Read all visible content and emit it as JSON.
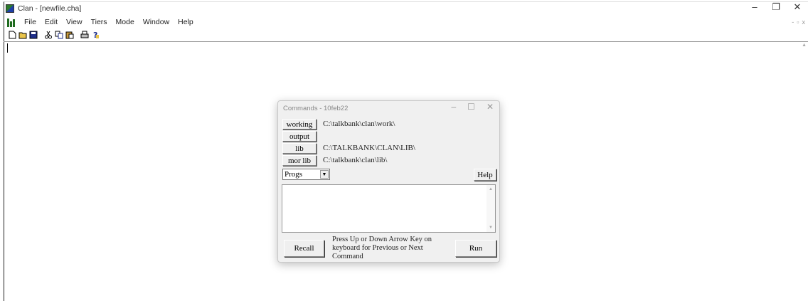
{
  "window": {
    "title": "Clan - [newfile.cha]",
    "minimize": "–",
    "restore": "❐",
    "close": "✕"
  },
  "menu": {
    "items": [
      "File",
      "Edit",
      "View",
      "Tiers",
      "Mode",
      "Window",
      "Help"
    ]
  },
  "mdi_controls": {
    "minimize": "-",
    "restore": "▫",
    "close": "x"
  },
  "toolbar": {
    "buttons": [
      "new-file",
      "open-file",
      "save",
      "cut",
      "copy",
      "paste",
      "print",
      "help"
    ]
  },
  "dialog": {
    "title": "Commands - 10feb22",
    "minimize": "–",
    "maximize": "☐",
    "close": "✕",
    "working_label": "working",
    "working_path": "C:\\talkbank\\clan\\work\\",
    "output_label": "output",
    "output_path": "",
    "lib_label": "lib",
    "lib_path": "C:\\TALKBANK\\CLAN\\LIB\\",
    "mor_lib_label": "mor lib",
    "mor_lib_path": "C:\\talkbank\\clan\\lib\\",
    "progs_value": "Progs",
    "help_label": "Help",
    "command_text": "",
    "recall_label": "Recall",
    "hint_text": "Press Up or Down Arrow Key on keyboard for Previous or Next Command",
    "run_label": "Run"
  },
  "colors": {
    "dialog_bg": "#f0f0f0",
    "app_icon_green": "#2c7a2c",
    "app_icon_blue": "#1d3fa8"
  }
}
